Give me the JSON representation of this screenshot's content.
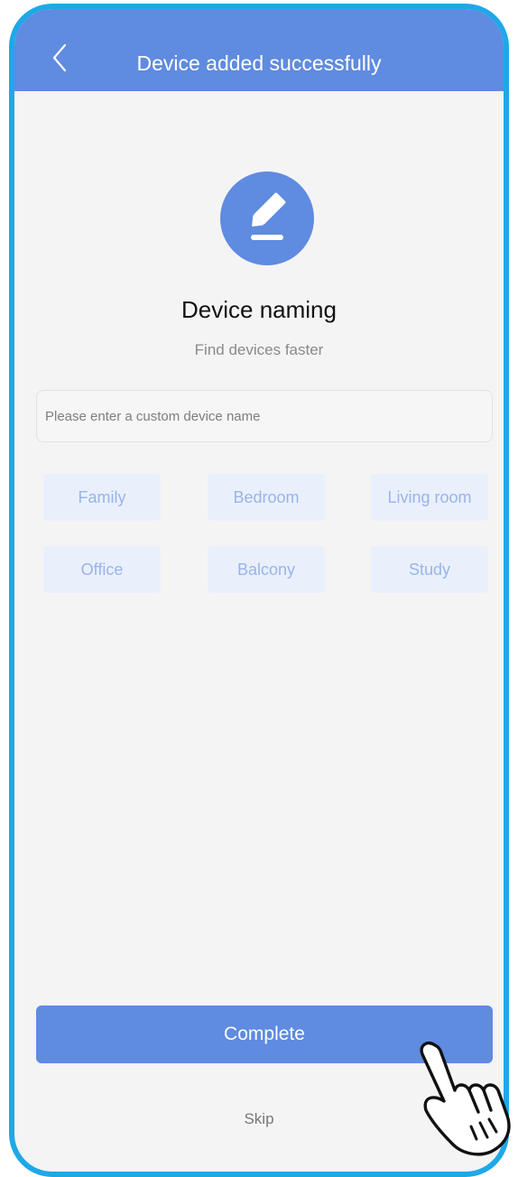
{
  "header": {
    "title": "Device added successfully",
    "back_icon": "chevron-left-icon"
  },
  "naming": {
    "icon": "edit-icon",
    "title": "Device naming",
    "subtitle": "Find devices faster"
  },
  "input": {
    "value": "",
    "placeholder": "Please enter a custom device name"
  },
  "chips": [
    {
      "label": "Family"
    },
    {
      "label": "Bedroom"
    },
    {
      "label": "Living room"
    },
    {
      "label": "Office"
    },
    {
      "label": "Balcony"
    },
    {
      "label": "Study"
    }
  ],
  "actions": {
    "complete_label": "Complete",
    "skip_label": "Skip"
  },
  "pointer": {
    "icon": "hand-pointer-icon"
  },
  "colors": {
    "accent": "#5f8be0",
    "frame": "#1fa8e8",
    "chip_bg": "#eaf0fb",
    "chip_text": "#98b4e9",
    "background": "#f4f4f4"
  }
}
